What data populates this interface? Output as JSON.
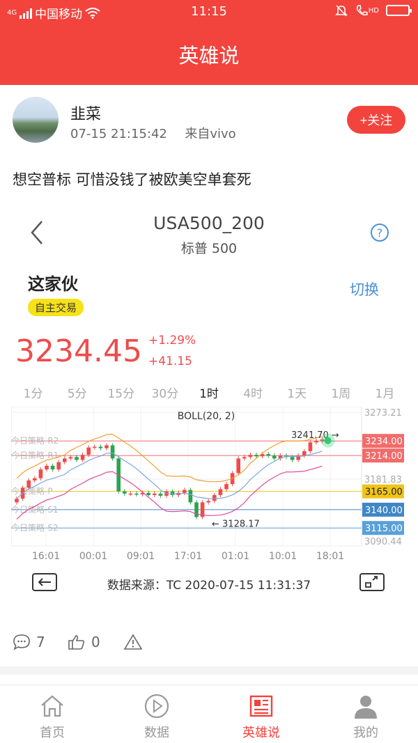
{
  "status_bar": {
    "network": "4G",
    "carrier": "中国移动",
    "time": "11:15",
    "hd": "HD"
  },
  "header": {
    "title": "英雄说"
  },
  "post": {
    "author": "韭菜",
    "datetime": "07-15 21:15:42",
    "source": "来自vivo",
    "follow_label": "+关注",
    "text": "想空普标 可惜没钱了被欧美空单套死"
  },
  "card": {
    "symbol": "USA500_200",
    "symbol_name": "标普 500",
    "help": "?",
    "trader": "这家伙",
    "switch_label": "切换",
    "tag": "自主交易",
    "price": "3234.45",
    "change_pct": "+1.29%",
    "change_abs": "+41.15",
    "timeframes": [
      "1分",
      "5分",
      "15分",
      "30分",
      "1时",
      "4时",
      "1天",
      "1周",
      "1月"
    ],
    "active_timeframe": "1时",
    "source_label": "数据来源：TC  2020-07-15 11:31:37"
  },
  "chart_data": {
    "type": "candlestick",
    "title": "BOLL(20, 2)",
    "ylim": [
      3090.44,
      3273.21
    ],
    "y_ticks": [
      "3273.21",
      "3181.83",
      "3090.44"
    ],
    "x_ticks": [
      "16:01",
      "00:01",
      "09:01",
      "17:01",
      "01:01",
      "10:01",
      "18:01"
    ],
    "levels": [
      {
        "name": "今日策略-R2",
        "value": 3234.0,
        "label": "3234.00",
        "color": "#f26b6b"
      },
      {
        "name": "今日策略-R1",
        "value": 3214.0,
        "label": "3214.00",
        "color": "#f26b6b"
      },
      {
        "name": "今日策略-P",
        "value": 3165.0,
        "label": "3165.00",
        "color": "#f0c419"
      },
      {
        "name": "今日策略-S1",
        "value": 3140.0,
        "label": "3140.00",
        "color": "#3f86c6"
      },
      {
        "name": "今日策略-S2",
        "value": 3115.0,
        "label": "3115.00",
        "color": "#5aa0d8"
      }
    ],
    "annotations": [
      {
        "text": "3241.70 →",
        "value": 3241.7
      },
      {
        "text": "← 3128.17",
        "value": 3128.17
      }
    ],
    "last_price": 3234.45
  },
  "actions": {
    "comments": "7",
    "likes": "0"
  },
  "tabs": [
    {
      "label": "首页",
      "icon": "home-icon"
    },
    {
      "label": "数据",
      "icon": "play-icon"
    },
    {
      "label": "英雄说",
      "icon": "news-icon"
    },
    {
      "label": "我的",
      "icon": "user-icon"
    }
  ],
  "colors": {
    "brand": "#f2433d",
    "up": "#ef4b4b",
    "down": "#2aa44f",
    "link": "#4a90d9"
  }
}
